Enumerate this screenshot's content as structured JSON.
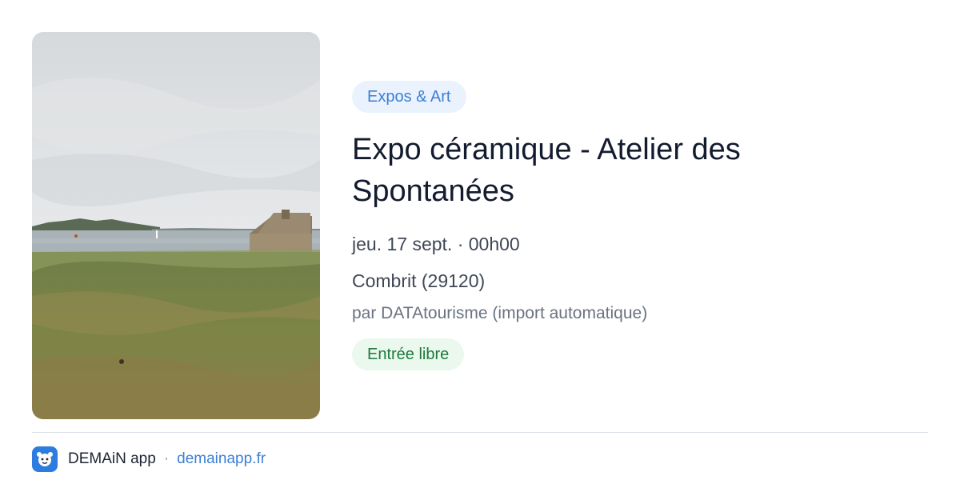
{
  "event": {
    "category": "Expos & Art",
    "title": "Expo céramique - Atelier des Spontanées",
    "datetime": "jeu. 17 sept. · 00h00",
    "location": "Combrit (29120)",
    "organizer": "par DATAtourisme (import automatique)",
    "price": "Entrée libre"
  },
  "footer": {
    "app_name": "DEMAiN app",
    "separator": "·",
    "url": "demainapp.fr"
  },
  "colors": {
    "category_chip_bg": "#eaf2fe",
    "category_chip_text": "#3d7fd4",
    "price_chip_bg": "#eaf8ee",
    "price_chip_text": "#1f7a3d",
    "link": "#3d7fd4",
    "app_icon": "#2d7de0"
  },
  "icons": {
    "app_logo": "demain-app-icon"
  }
}
